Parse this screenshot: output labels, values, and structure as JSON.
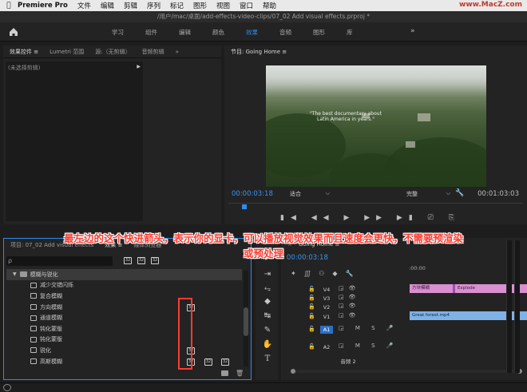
{
  "menubar": {
    "app_name": "Premiere Pro",
    "items": [
      "文件",
      "编辑",
      "剪辑",
      "序列",
      "标记",
      "图形",
      "视图",
      "窗口",
      "帮助"
    ],
    "watermark": "www.MacZ.com"
  },
  "window": {
    "title": "/用户/mac/桌面/add-effects-video-clips/07_02 Add visual effects.prproj *"
  },
  "workspaces": {
    "tabs": [
      "学习",
      "组件",
      "编辑",
      "颜色",
      "效果",
      "音频",
      "图形",
      "库"
    ],
    "active": "效果",
    "more": "»"
  },
  "effect_controls": {
    "tabs": [
      "效果控件 ≡",
      "Lumetri 范围",
      "源:（无剪辑）",
      "音频剪辑",
      "»"
    ],
    "selection": "(未选择剪辑)"
  },
  "program_monitor": {
    "title": "节目: Going Home ≡",
    "caption_line1": "\"The best documentary about",
    "caption_line2": "Latin America in years.\"",
    "timecode_left": "00:00:03:18",
    "fit": "适合",
    "quality": "完整",
    "timecode_right": "00:01:03:03"
  },
  "annotation": {
    "line1": "最左边的这个快进箭头，表示你的显卡，可以播放视觉效果而且速度会更快，不需要预渲染",
    "line2": "或预处理"
  },
  "project_panel": {
    "tabs": [
      "项目: 07_02 Add visual effects",
      "效果 ≡",
      "媒体浏览器"
    ],
    "search_placeholder": "ρ",
    "folder": "模糊与锐化",
    "items": [
      {
        "label": "减少交错闪烁",
        "b1": false,
        "b2": false,
        "b3": false
      },
      {
        "label": "复合模糊",
        "b1": false,
        "b2": false,
        "b3": false
      },
      {
        "label": "方向模糊",
        "b1": true,
        "b2": false,
        "b3": false
      },
      {
        "label": "通道模糊",
        "b1": false,
        "b2": false,
        "b3": false
      },
      {
        "label": "钝化蒙版",
        "b1": false,
        "b2": false,
        "b3": false
      },
      {
        "label": "钝化蒙版",
        "b1": false,
        "b2": false,
        "b3": false
      },
      {
        "label": "锐化",
        "b1": true,
        "b2": false,
        "b3": false
      },
      {
        "label": "高斯模糊",
        "b1": true,
        "b2": true,
        "b3": true
      }
    ],
    "badge_text": "32"
  },
  "timeline": {
    "title": "Going Home ≡",
    "timecode": "00:00:03:18",
    "ruler_label": ":00:00",
    "tracks": [
      {
        "name": "V4",
        "selected": false
      },
      {
        "name": "V3",
        "selected": false
      },
      {
        "name": "V2",
        "selected": false
      },
      {
        "name": "V1",
        "selected": false
      },
      {
        "name": "A1",
        "selected": true
      },
      {
        "name": "A2",
        "selected": false
      },
      {
        "name": "音频 2",
        "selected": false
      }
    ],
    "clips": {
      "title_clip": "方块模糊",
      "explode_clip": "Explode",
      "video_clip": "Great forest.mp4"
    },
    "audio_track_letters": [
      "M",
      "S"
    ]
  },
  "colors": {
    "accent": "#2d8ceb",
    "annotation": "#ff3b30",
    "clip_pink": "#d98fd0",
    "clip_blue": "#7fb2e6"
  }
}
